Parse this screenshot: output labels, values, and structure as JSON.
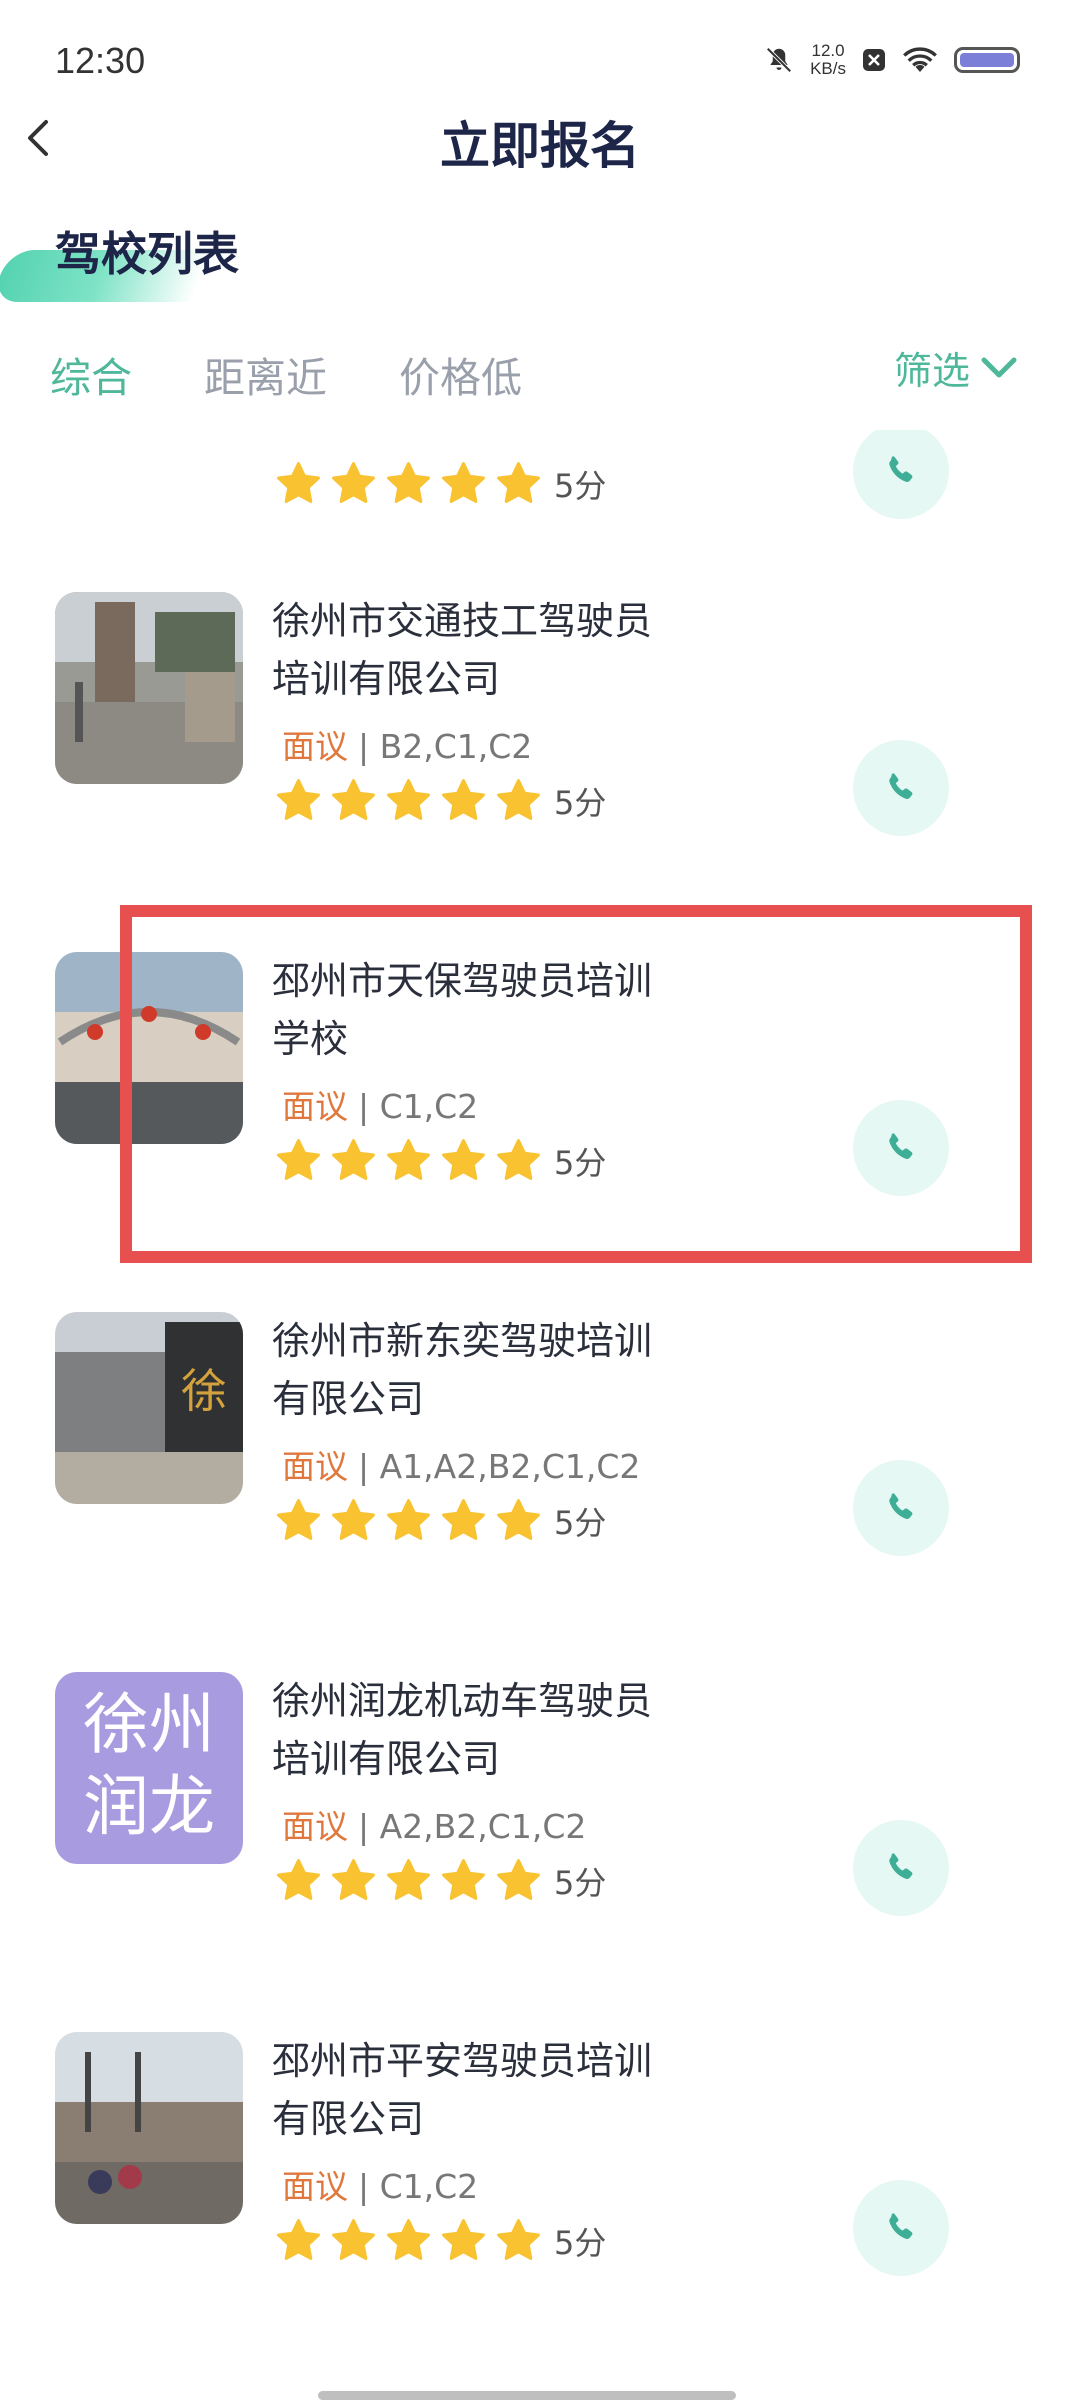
{
  "status": {
    "time": "12:30",
    "net_speed_value": "12.0",
    "net_speed_unit": "KB/s"
  },
  "header": {
    "title": "立即报名"
  },
  "section": {
    "title": "驾校列表"
  },
  "tabs": [
    "综合",
    "距离近",
    "价格低"
  ],
  "filter": {
    "label": "筛选"
  },
  "colors": {
    "accent": "#4fb89a",
    "price": "#e0783e",
    "star": "#f8c231",
    "highlight": "#e8504f"
  },
  "partial_item": {
    "score": "5分"
  },
  "schools": [
    {
      "name_line1": "徐州市交通技工驾驶员",
      "name_line2": "培训有限公司",
      "price": "面议",
      "licenses": "| B2,C1,C2",
      "score": "5分"
    },
    {
      "name_line1": "邳州市天保驾驶员培训",
      "name_line2": "学校",
      "price": "面议",
      "licenses": "| C1,C2",
      "score": "5分"
    },
    {
      "name_line1": "徐州市新东奕驾驶培训",
      "name_line2": "有限公司",
      "price": "面议",
      "licenses": "| A1,A2,B2,C1,C2",
      "score": "5分"
    },
    {
      "name_line1": "徐州润龙机动车驾驶员",
      "name_line2": "培训有限公司",
      "price": "面议",
      "licenses": "| A2,B2,C1,C2",
      "score": "5分",
      "logo_text_1": "徐州",
      "logo_text_2": "润龙"
    },
    {
      "name_line1": "邳州市平安驾驶员培训",
      "name_line2": "有限公司",
      "price": "面议",
      "licenses": "| C1,C2",
      "score": "5分"
    }
  ]
}
